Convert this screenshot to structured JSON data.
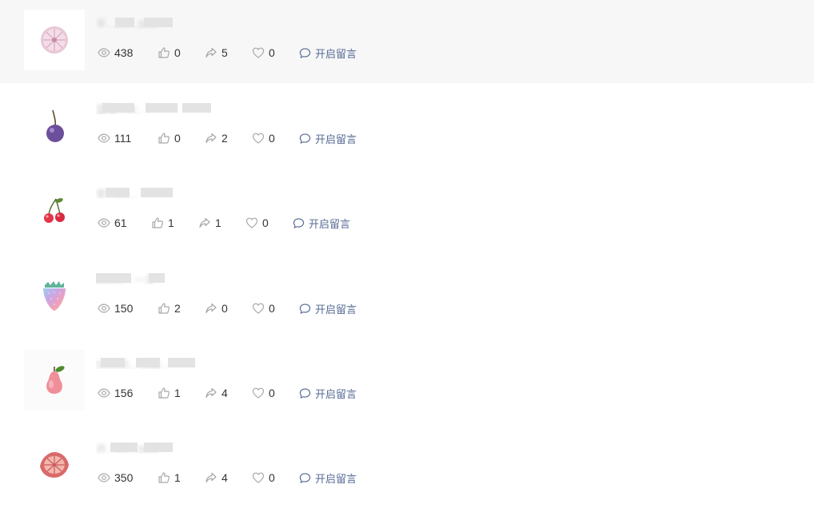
{
  "list": {
    "comment_label": "开启留言",
    "items": [
      {
        "title": "平…大…30天",
        "views": "438",
        "likes": "0",
        "shares": "5",
        "favorites": "0",
        "icon": "sliced-dragonfruit-icon"
      },
      {
        "title": "蓝莓…大…",
        "views": "111",
        "likes": "0",
        "shares": "2",
        "favorites": "0",
        "icon": "plum-cherry-icon"
      },
      {
        "title": "早…大…",
        "views": "61",
        "likes": "1",
        "shares": "1",
        "favorites": "0",
        "icon": "cherries-icon"
      },
      {
        "title": "100元…一次",
        "views": "150",
        "likes": "2",
        "shares": "0",
        "favorites": "0",
        "icon": "rainbow-strawberry-icon"
      },
      {
        "title": "5000元…领取…",
        "views": "156",
        "likes": "1",
        "shares": "4",
        "favorites": "0",
        "icon": "pink-pear-icon"
      },
      {
        "title": "开…大…30天",
        "views": "350",
        "likes": "1",
        "shares": "4",
        "favorites": "0",
        "icon": "starfruit-slice-icon"
      }
    ]
  }
}
